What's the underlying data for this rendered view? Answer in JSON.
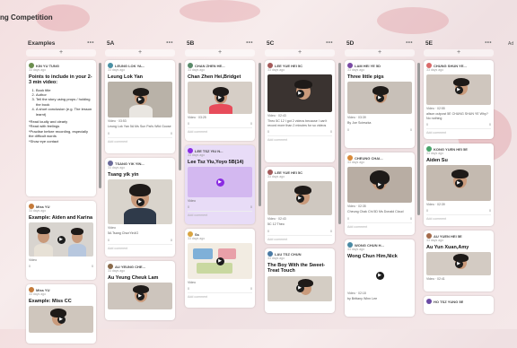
{
  "board": {
    "title": "ng Competition"
  },
  "columns": [
    {
      "name": "Examples",
      "cards": [
        {
          "author": "KIN YU TUNG",
          "time": "33 days ago",
          "title": "Points to include in your 2-3 min video:",
          "list": [
            "Book title",
            "Author",
            "Tell the story using props / holding the book",
            "A short conclusion (e.g. The lesson learnt)"
          ],
          "notes": [
            "*Read loudly and clearly",
            "*Read with feelings",
            "*Practise before recording, especially the difficult words",
            "*Show eye contact"
          ]
        },
        {
          "author": "Miss YU",
          "time": "33 days ago",
          "title": "Example: Aiden and Karina",
          "video": "Video",
          "like": "0",
          "comments": "0"
        },
        {
          "author": "Miss YU",
          "time": "33 days ago",
          "title": "Example: Miss CC"
        }
      ]
    },
    {
      "name": "5A",
      "cards": [
        {
          "author": "LEUNG LOK YA...",
          "time": "33 days ago",
          "title": "Leung Lok Yan",
          "video": "Video · 03:53",
          "body": "Leung Lok Yan 5A Ms Sun Pat's Wild Goose",
          "like": "0",
          "comments": "0"
        },
        {
          "author": "TSANG YIK YIN...",
          "time": "33 days ago",
          "title": "Tsang yik yin",
          "video": "Video",
          "body": "5A Tsang ChunYin4G",
          "like": "0",
          "comments": "0"
        },
        {
          "author": "AU YEUNG CHE...",
          "time": "33 days ago",
          "title": "Au Yeung Cheuk Lam"
        }
      ]
    },
    {
      "name": "5B",
      "cards": [
        {
          "author": "CHAN ZHEN HE...",
          "time": "33 days ago",
          "title": "Chan Zhen Hei,Bridget",
          "video": "Video · 03:25",
          "like": "0",
          "comments": "0"
        },
        {
          "author": "LEE TSZ YIU N...",
          "time": "33 days ago",
          "title": "Lee Tsz Yiu,Yoyo 5B(14)",
          "video": "Video",
          "like": "0",
          "comments": "0",
          "purple": true
        },
        {
          "author": "Ss",
          "time": "33 days ago",
          "title": "",
          "video": "Video",
          "like": "0",
          "comments": "0"
        }
      ]
    },
    {
      "name": "5C",
      "cards": [
        {
          "author": "LEE YUE HEI 5C",
          "time": "33 days ago",
          "title": "",
          "video": "Video · 02:43",
          "body": "Theo 5C 12 I got 2 videos because I can't record more than 2 minutes for so videos",
          "like": "0",
          "comments": "0"
        },
        {
          "author": "LEE YUE HEI 5C",
          "time": "33 days ago",
          "title": "",
          "video": "Video · 02:43",
          "body": "5C 12 Theo",
          "like": "0",
          "comments": "0"
        },
        {
          "author": "LAU TSZ CHUN",
          "time": "33 days ago",
          "title": "The Boy With the Sweet-Treat Touch"
        }
      ]
    },
    {
      "name": "5D",
      "cards": [
        {
          "author": "LAM HEI YE 5D",
          "time": "33 days ago",
          "title": "Three little pigs",
          "video": "Video · 03:39",
          "body": "By Joe Scieszka",
          "like": "0",
          "comments": "0"
        },
        {
          "author": "CHEUNG CHAI...",
          "time": "33 days ago",
          "title": "",
          "video": "Video · 02:35",
          "body": "Cheung Chak Chi 5D Ms Donald Cloud",
          "like": "0",
          "comments": "0"
        },
        {
          "author": "WONG CHUN H...",
          "time": "33 days ago",
          "title": "Wong Chun Him,Nick",
          "video": "Video · 02:18",
          "body": "by Brittany Winn Lee"
        }
      ]
    },
    {
      "name": "5E",
      "cards": [
        {
          "author": "CHUNG SHUN YE...",
          "time": "33 days ago",
          "title": "",
          "video": "Video · 02:55",
          "body": "alison outpost 5E CHUNG SHUN YE Why? No nothing",
          "like": "0",
          "comments": "0"
        },
        {
          "author": "KONG YUEN HEI 5E",
          "time": "33 days ago",
          "title": "Aiden Su",
          "video": "Video · 02:39",
          "like": "0",
          "comments": "0"
        },
        {
          "author": "AU YUEN HEI 5E",
          "time": "33 days ago",
          "title": "Au Yun Xuan,Amy",
          "video": "Video · 02:41"
        },
        {
          "author": "HO TSZ YUNG 5E",
          "time": "33 days ago",
          "title": ""
        }
      ]
    }
  ],
  "ui": {
    "plus": "+",
    "add_comment": "Add comment",
    "dots": "•••",
    "kebab": "⋮",
    "edge_text": "Ad"
  }
}
